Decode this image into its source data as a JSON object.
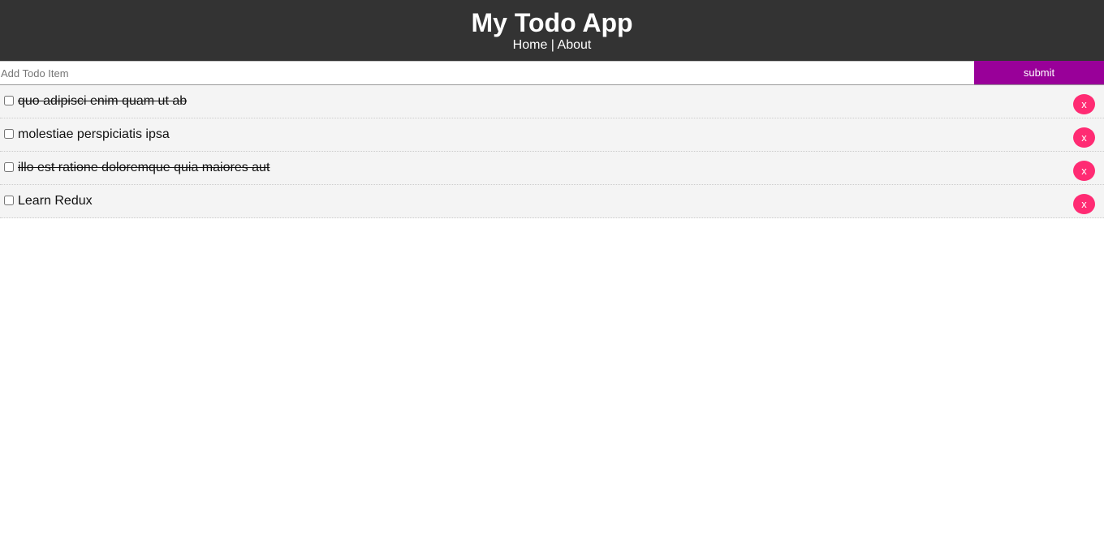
{
  "header": {
    "title": "My Todo App",
    "nav": {
      "home": "Home",
      "separator": "|",
      "about": "About"
    }
  },
  "add_form": {
    "placeholder": "Add Todo Item",
    "value": "",
    "submit_label": "submit"
  },
  "todos": [
    {
      "title": "quo adipisci enim quam ut ab",
      "completed": true,
      "delete_label": "x"
    },
    {
      "title": "molestiae perspiciatis ipsa",
      "completed": false,
      "delete_label": "x"
    },
    {
      "title": "illo est ratione doloremque quia maiores aut",
      "completed": true,
      "delete_label": "x"
    },
    {
      "title": "Learn Redux",
      "completed": false,
      "delete_label": "x"
    }
  ],
  "colors": {
    "header_bg": "#333333",
    "submit_bg": "#990099",
    "delete_bg": "#ff2b73",
    "item_bg": "#f4f4f4"
  }
}
